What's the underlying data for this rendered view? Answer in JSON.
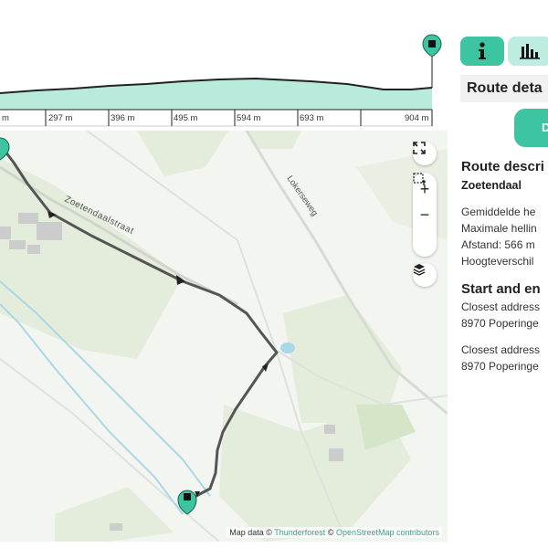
{
  "profile": {
    "x_labels": [
      "m",
      "297 m",
      "396 m",
      "495 m",
      "594 m",
      "693 m",
      "904 m"
    ],
    "fill_color": "#b8ebdb",
    "line_color": "#222222"
  },
  "map": {
    "streets": {
      "zoetendaalstraat": "Zoetendaalstraat",
      "lokerseweg": "Lokerseweg"
    },
    "attribution": {
      "prefix": "Map data ©",
      "thunderforest": "Thunderforest",
      "sep": "©",
      "osm": "OpenStreetMap contributors"
    },
    "controls": {
      "zoom_in": "+",
      "zoom_out": "−"
    }
  },
  "panel": {
    "tabs": [
      {
        "name": "info",
        "icon": "info-icon",
        "active": true
      },
      {
        "name": "chart",
        "icon": "bar-chart-icon",
        "active": false
      }
    ],
    "detail_header": "Route deta",
    "download_label": "D",
    "route_description": {
      "title": "Route descri",
      "name": "Zoetendaal",
      "lines": [
        "Gemiddelde he",
        "Maximale hellin",
        "Afstand: 566 m",
        "Hoogteverschil"
      ]
    },
    "start_end": {
      "title": "Start and en",
      "start": [
        "Closest address",
        "8970 Poperinge"
      ],
      "end": [
        "Closest address",
        "8970 Poperinge"
      ]
    },
    "accent_color": "#3dc4a0"
  }
}
